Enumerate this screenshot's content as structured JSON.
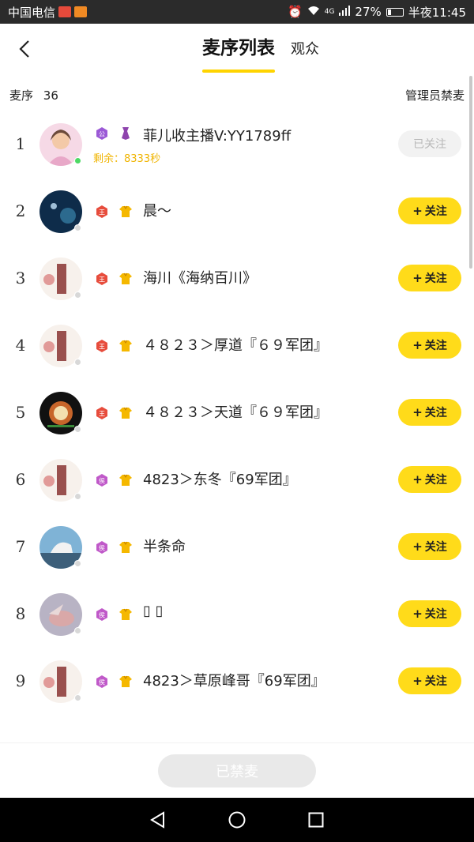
{
  "status_bar": {
    "carrier": "中国电信",
    "network": "4G",
    "battery": "27%",
    "battery_level": 0.27,
    "time": "半夜11:45"
  },
  "header": {
    "tab_active": "麦序列表",
    "tab_other": "观众"
  },
  "list_header": {
    "label": "麦序",
    "count": "36",
    "admin_action": "管理员禁麦"
  },
  "rows": [
    {
      "rank": "1",
      "badges": [
        "purple-gong",
        "purple-tie"
      ],
      "nickname": "菲儿收主播V:YY1789ff",
      "remain": "剩余：8333秒",
      "follow": "已关注",
      "followed": true,
      "online": true
    },
    {
      "rank": "2",
      "badges": [
        "red-king",
        "gold-shirt"
      ],
      "nickname": "晨～",
      "follow": "关注",
      "followed": false,
      "online": false
    },
    {
      "rank": "3",
      "badges": [
        "red-king",
        "gold-shirt"
      ],
      "nickname": "海川《海纳百川》",
      "follow": "关注",
      "followed": false,
      "online": false
    },
    {
      "rank": "4",
      "badges": [
        "red-king",
        "gold-shirt"
      ],
      "nickname": "４８２３＞厚道『６９军团』",
      "follow": "关注",
      "followed": false,
      "online": false
    },
    {
      "rank": "5",
      "badges": [
        "red-king",
        "gold-shirt"
      ],
      "nickname": "４８２３＞天道『６９军团』",
      "follow": "关注",
      "followed": false,
      "online": false
    },
    {
      "rank": "6",
      "badges": [
        "purple-hou",
        "gold-shirt"
      ],
      "nickname": "4823＞东冬『69军团』",
      "follow": "关注",
      "followed": false,
      "online": false
    },
    {
      "rank": "7",
      "badges": [
        "purple-hou",
        "gold-shirt"
      ],
      "nickname": "半条命",
      "follow": "关注",
      "followed": false,
      "online": false
    },
    {
      "rank": "8",
      "badges": [
        "purple-hou",
        "gold-shirt"
      ],
      "nickname": "▯          ▯",
      "follow": "关注",
      "followed": false,
      "online": false
    },
    {
      "rank": "9",
      "badges": [
        "purple-hou",
        "gold-shirt"
      ],
      "nickname": "4823＞草原峰哥『69军团』",
      "follow": "关注",
      "followed": false,
      "online": false
    }
  ],
  "bottom": {
    "ban_button": "已禁麦"
  },
  "colors": {
    "accent": "#ffdb1a",
    "remain": "#f0b400",
    "online": "#4cd964"
  }
}
